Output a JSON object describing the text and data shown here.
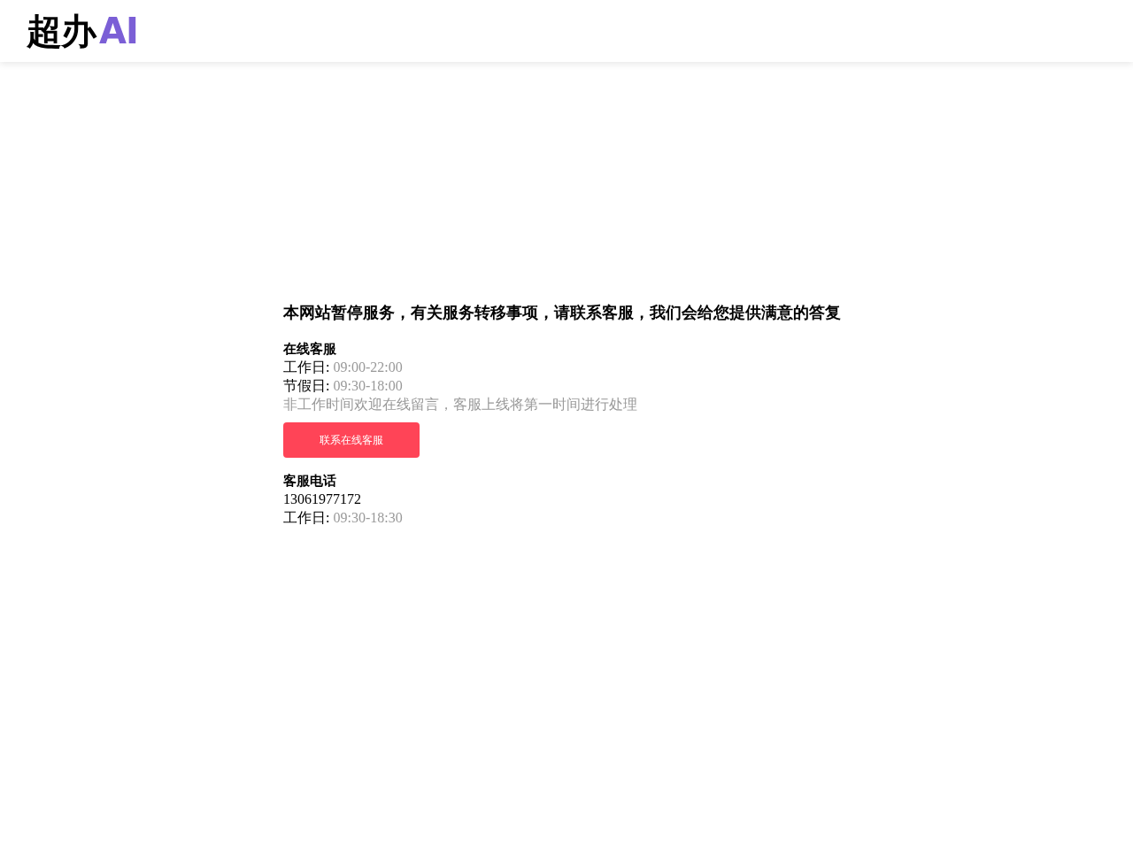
{
  "header": {
    "logo": {
      "main": "超办",
      "accent": "AI"
    }
  },
  "notice": {
    "title": "本网站暂停服务，有关服务转移事项，请联系客服，我们会给您提供满意的答复",
    "sections": [
      {
        "kind": "online",
        "heading": "在线客服",
        "hours": [
          {
            "label": "工作日:",
            "value": "09:00-22:00"
          },
          {
            "label": "节假日:",
            "value": "09:30-18:00"
          }
        ],
        "note": "非工作时间欢迎在线留言，客服上线将第一时间进行处理",
        "button": "联系在线客服"
      },
      {
        "kind": "phone",
        "heading": "客服电话",
        "phone": "13061977172",
        "hours": [
          {
            "label": "工作日:",
            "value": "09:30-18:30"
          }
        ]
      }
    ]
  }
}
